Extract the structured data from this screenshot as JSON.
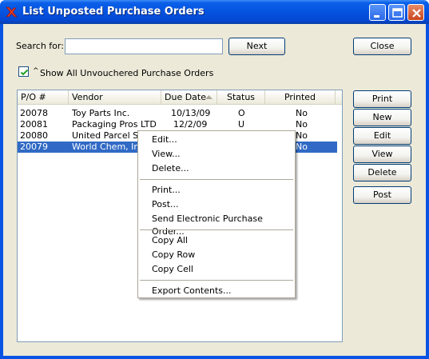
{
  "window": {
    "title": "List Unposted Purchase Orders"
  },
  "search": {
    "label": "Search for:",
    "value": "",
    "next_label": "Next"
  },
  "close_label": "Close",
  "show_all": {
    "label": "Show All Unvouchered Purchase Orders",
    "checked": true
  },
  "columns": [
    "P/O #",
    "Vendor",
    "Due Date",
    "Status",
    "Printed"
  ],
  "rows": [
    {
      "po": "20078",
      "vendor": "Toy Parts Inc.",
      "due": "10/13/09",
      "status": "O",
      "printed": "No"
    },
    {
      "po": "20081",
      "vendor": "Packaging Pros LTD",
      "due": "12/2/09",
      "status": "U",
      "printed": "No"
    },
    {
      "po": "20080",
      "vendor": "United Parcel Ser",
      "due": "",
      "status": "",
      "printed": "No"
    },
    {
      "po": "20079",
      "vendor": "World Chem, Inc.",
      "due": "",
      "status": "",
      "printed": "No",
      "selected": true
    }
  ],
  "side_buttons": [
    "Print",
    "New",
    "Edit",
    "View",
    "Delete",
    "Post"
  ],
  "context_menu": {
    "group1": [
      "Edit...",
      "View...",
      "Delete..."
    ],
    "group2": [
      "Print...",
      "Post...",
      "Send Electronic Purchase Order..."
    ],
    "group3": [
      "Copy All",
      "Copy Row",
      "Copy Cell"
    ],
    "group4": [
      "Export Contents..."
    ]
  },
  "colors": {
    "title_blue": "#0553e0",
    "selection": "#316ac5",
    "dialog_bg": "#ece9d8"
  }
}
